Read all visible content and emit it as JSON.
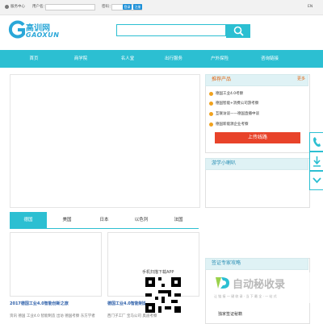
{
  "topbar": {
    "member_center": "服务中心",
    "username_label": "用户名：",
    "password_label": "密码：",
    "login_btn": "登录",
    "register_btn": "注册",
    "lang": "EN"
  },
  "logo": {
    "chinese": "高训网",
    "english": "GAOXUN"
  },
  "search": {
    "placeholder": ""
  },
  "nav": [
    "首页",
    "商学院",
    "名人堂",
    "出行服务",
    "户外探险",
    "咨询链接"
  ],
  "recommend": {
    "title": "推荐产品",
    "more": "更多",
    "items": [
      "德国工业4.0考察",
      "德国智能+消费公司游考察",
      "互联访谈——德国直播中谈",
      "德国新能源企业考察"
    ],
    "upload_btn": "上传线路"
  },
  "news_box": {
    "title": "游学小喇叭"
  },
  "country_tabs": [
    "德国",
    "美国",
    "日本",
    "以色列",
    "法国"
  ],
  "cards": [
    {
      "title": "2017德国工业4.0智能创新之旅",
      "desc": "资讯  德国  工业4.0  智能制造  出访  德国考察  东方学者"
    },
    {
      "title": "德国工业4.0智能制造",
      "desc": "西门子工厂  宝马公司  奥迪考察"
    }
  ],
  "qr": {
    "caption": "手机扫描下载APP"
  },
  "visa": {
    "title": "签证专家攻略",
    "exclusive": "独家签证秘籍"
  },
  "watermark": {
    "brand": "自动秘收录",
    "tagline": "让 链 接 一 键 收 录 · 当 下 最 全 · 一 站 式"
  }
}
